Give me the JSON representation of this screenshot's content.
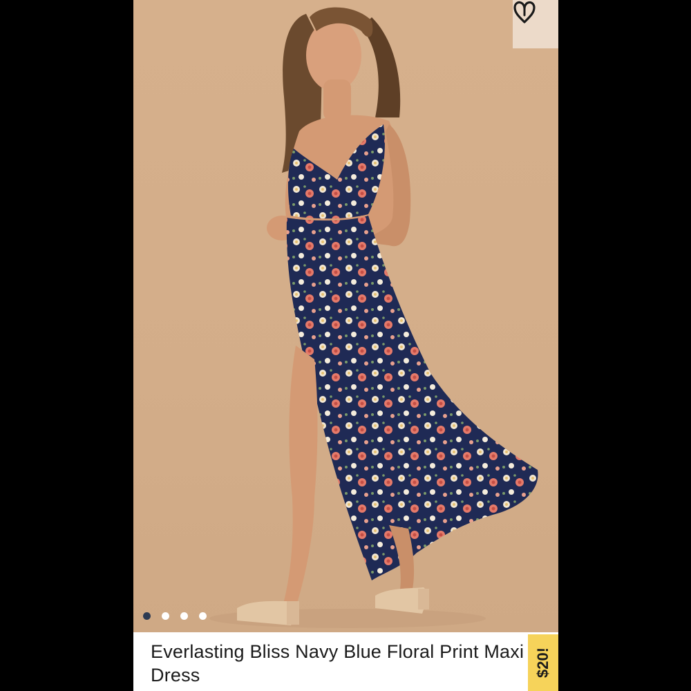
{
  "product": {
    "title": "Everlasting Bliss Navy Blue Floral Print Maxi Dress",
    "price_tag": "$20!"
  },
  "gallery": {
    "image_count": 4,
    "active_index": 0
  },
  "icons": {
    "favorite": "heart-icon"
  },
  "colors": {
    "background": "#d4ae8a",
    "price_tag": "#f6d35a",
    "dot_active": "#2c3a52",
    "dress": "#1f2a55"
  }
}
